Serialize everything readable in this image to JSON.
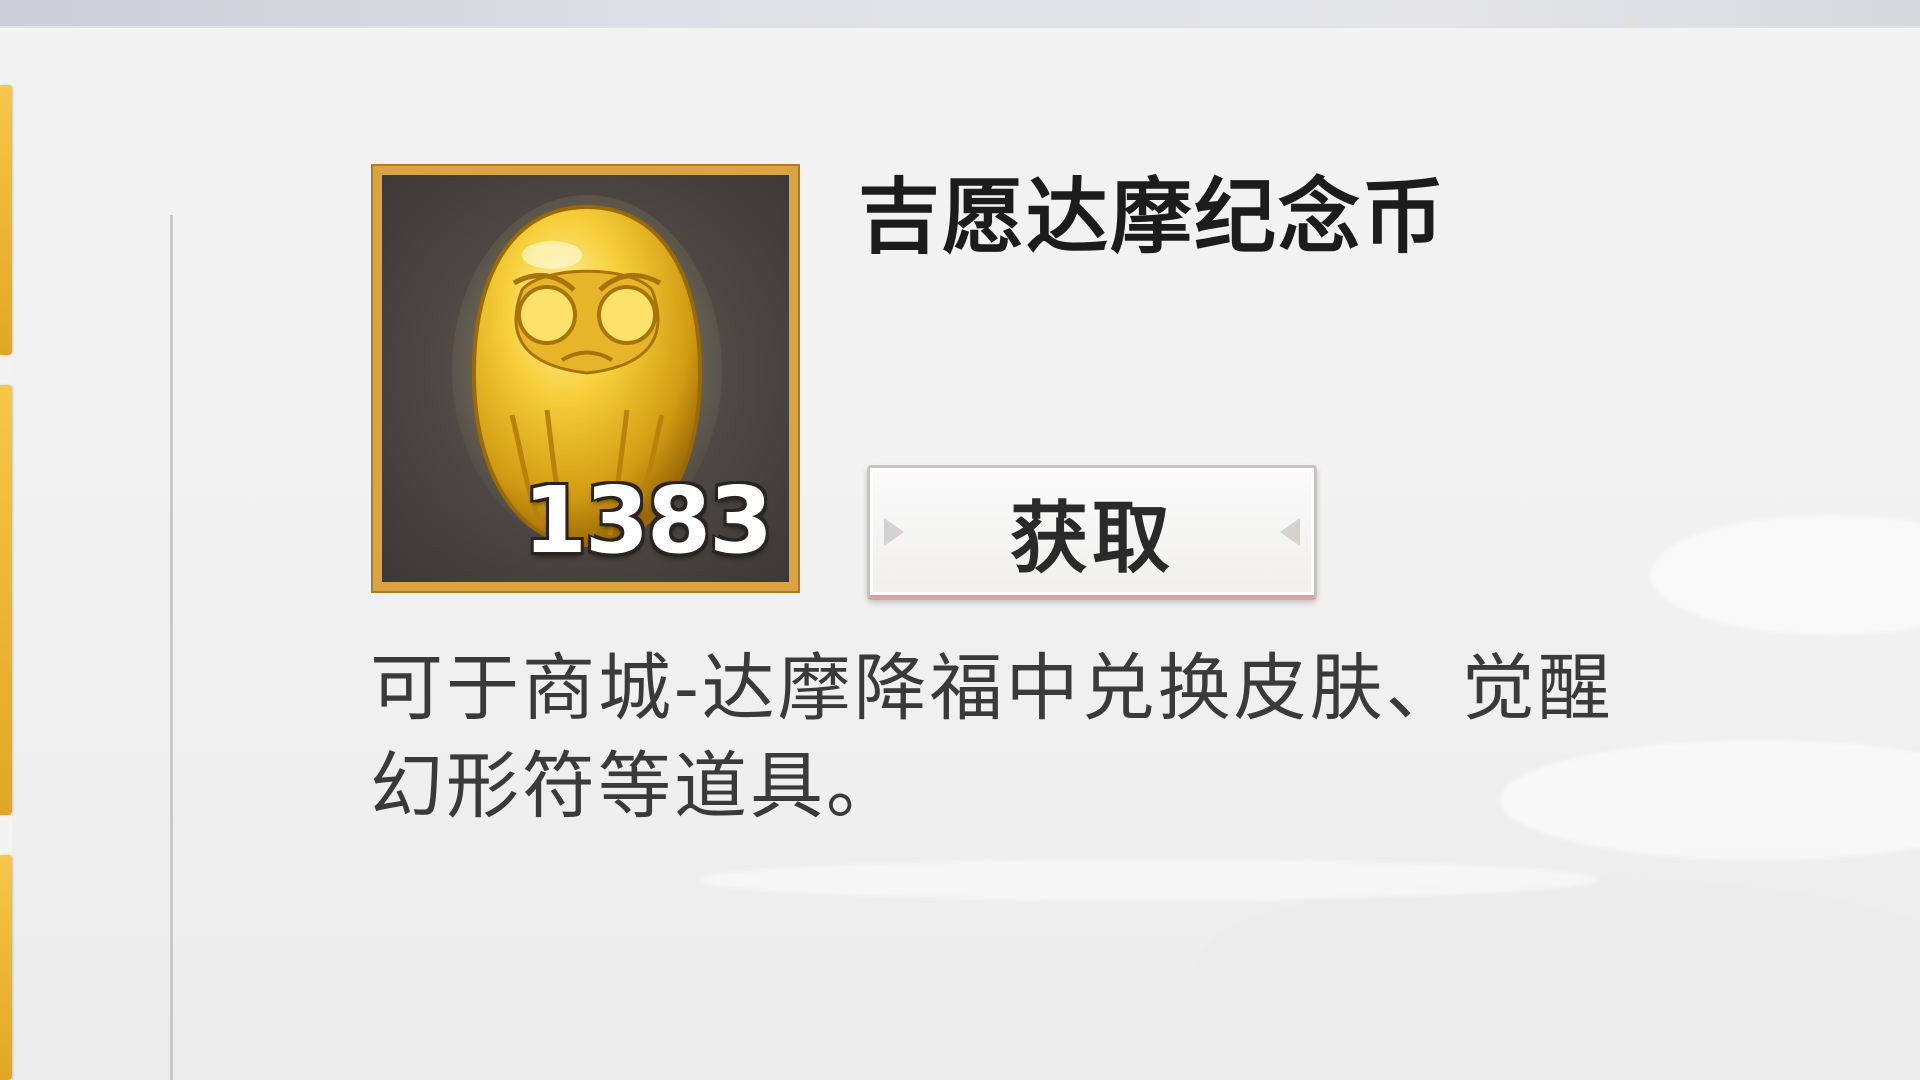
{
  "item": {
    "name": "吉愿达摩纪念币",
    "count": "1383",
    "icon": "golden-daruma-coin-icon",
    "frame_color": "#d9a441",
    "description": "可于商城-达摩降福中兑换皮肤、觉醒幻形符等道具。"
  },
  "actions": {
    "obtain_label": "获取"
  },
  "theme": {
    "accent_gold": "#f0b73a",
    "background": "#efefef",
    "text_dark": "#1c1c1c"
  }
}
